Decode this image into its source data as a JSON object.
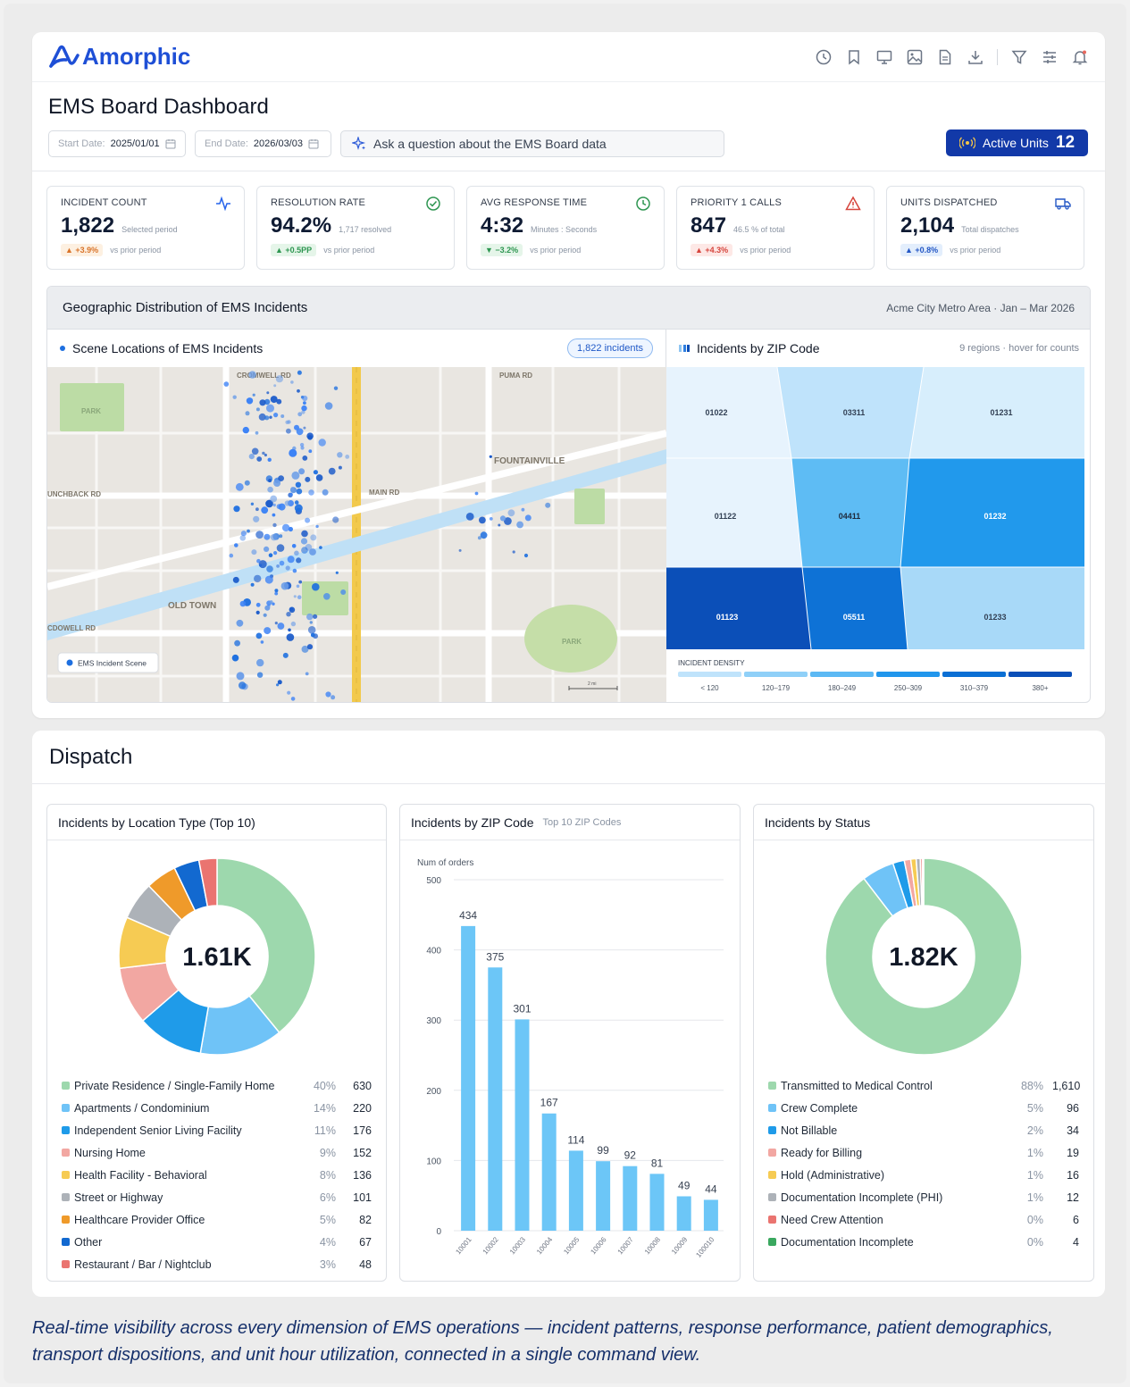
{
  "app": {
    "brand": "Amorphic",
    "brand_color": "#1e4fd6"
  },
  "toolbar_icons": [
    "history-icon",
    "bookmark-icon",
    "monitor-icon",
    "image-icon",
    "document-icon",
    "download-icon",
    "filter-icon",
    "settings-sliders-icon",
    "bell-icon"
  ],
  "header": {
    "title": "EMS Board Dashboard",
    "start_label": "Start Date:",
    "start_value": "2025/01/01",
    "end_label": "End Date:",
    "end_value": "2026/03/03",
    "ask_placeholder": "Ask a question about the EMS Board data",
    "active_units_label": "Active Units",
    "active_units_value": "12"
  },
  "kpis": [
    {
      "label": "INCIDENT COUNT",
      "value": "1,822",
      "sub": "Selected period",
      "delta": "▲ +3.9%",
      "delta_note": "vs prior period",
      "tone": "up-o",
      "icon": "pulse-icon"
    },
    {
      "label": "RESOLUTION RATE",
      "value": "94.2%",
      "sub": "1,717 resolved",
      "delta": "▲ +0.5PP",
      "delta_note": "vs prior period",
      "tone": "up-g",
      "icon": "check-circle-icon"
    },
    {
      "label": "AVG RESPONSE TIME",
      "value": "4:32",
      "sub": "Minutes : Seconds",
      "delta": "▼ −3.2%",
      "delta_note": "vs prior period",
      "tone": "down-g",
      "icon": "clock-icon"
    },
    {
      "label": "PRIORITY 1 CALLS",
      "value": "847",
      "sub": "46.5 % of total",
      "delta": "▲ +4.3%",
      "delta_note": "vs prior period",
      "tone": "up-r",
      "icon": "warning-icon"
    },
    {
      "label": "UNITS DISPATCHED",
      "value": "2,104",
      "sub": "Total dispatches",
      "delta": "▲ +0.8%",
      "delta_note": "vs prior period",
      "tone": "up-b",
      "icon": "truck-icon"
    }
  ],
  "geo": {
    "title": "Geographic Distribution of EMS Incidents",
    "subtitle": "Acme City Metro Area · Jan – Mar 2026",
    "map_title": "Scene Locations of EMS Incidents",
    "map_badge": "1,822 incidents",
    "map_legend": "EMS Incident Scene",
    "scale_label": "2 mi",
    "road_labels": [
      "CROMWELL RD",
      "PUMA RD",
      "FOUNTAINVILLE",
      "UNCHBACK RD",
      "MAIN RD",
      "OLD TOWN",
      "CDOWELL RD",
      "PARK",
      "PARK"
    ],
    "zip_title": "Incidents by ZIP Code",
    "zip_hint": "9 regions · hover for counts",
    "zip_cells": [
      "01022",
      "03311",
      "01231",
      "01122",
      "04411",
      "01232",
      "01123",
      "05511",
      "01233"
    ],
    "density_title": "INCIDENT DENSITY",
    "density_bins": [
      "< 120",
      "120–179",
      "180–249",
      "250–309",
      "310–379",
      "380+"
    ],
    "density_colors": [
      "#bfe3fb",
      "#8fd0f8",
      "#5cb9f4",
      "#2196ec",
      "#0b6fd4",
      "#0b4fb8"
    ]
  },
  "dispatch": {
    "title": "Dispatch",
    "location_panel": {
      "title": "Incidents by Location Type (Top 10)",
      "center": "1.61K",
      "items": [
        {
          "name": "Private Residence / Single-Family Home",
          "pct": "40%",
          "value": "630",
          "color": "#9dd8ad"
        },
        {
          "name": "Apartments / Condominium",
          "pct": "14%",
          "value": "220",
          "color": "#6fc3f7"
        },
        {
          "name": "Independent Senior Living Facility",
          "pct": "11%",
          "value": "176",
          "color": "#1f9be9"
        },
        {
          "name": "Nursing Home",
          "pct": "9%",
          "value": "152",
          "color": "#f2a7a2"
        },
        {
          "name": "Health Facility - Behavioral",
          "pct": "8%",
          "value": "136",
          "color": "#f6cb53"
        },
        {
          "name": "Street or Highway",
          "pct": "6%",
          "value": "101",
          "color": "#adb2b8"
        },
        {
          "name": "Healthcare Provider Office",
          "pct": "5%",
          "value": "82",
          "color": "#ef9a2a"
        },
        {
          "name": "Other",
          "pct": "4%",
          "value": "67",
          "color": "#1269d0"
        },
        {
          "name": "Restaurant / Bar / Nightclub",
          "pct": "3%",
          "value": "48",
          "color": "#ea7470"
        }
      ]
    },
    "zip_panel": {
      "title": "Incidents by ZIP Code",
      "subtitle": "Top 10 ZIP Codes"
    },
    "status_panel": {
      "title": "Incidents by Status",
      "center": "1.82K",
      "items": [
        {
          "name": "Transmitted to Medical Control",
          "pct": "88%",
          "value": "1,610",
          "color": "#9dd8ad"
        },
        {
          "name": "Crew Complete",
          "pct": "5%",
          "value": "96",
          "color": "#6fc3f7"
        },
        {
          "name": "Not Billable",
          "pct": "2%",
          "value": "34",
          "color": "#1f9be9"
        },
        {
          "name": "Ready for Billing",
          "pct": "1%",
          "value": "19",
          "color": "#f2a7a2"
        },
        {
          "name": "Hold (Administrative)",
          "pct": "1%",
          "value": "16",
          "color": "#f6cb53"
        },
        {
          "name": "Documentation Incomplete (PHI)",
          "pct": "1%",
          "value": "12",
          "color": "#adb2b8"
        },
        {
          "name": "Need Crew Attention",
          "pct": "0%",
          "value": "6",
          "color": "#ea7470"
        },
        {
          "name": "Documentation Incomplete",
          "pct": "0%",
          "value": "4",
          "color": "#3aa85f"
        }
      ]
    }
  },
  "chart_data": [
    {
      "type": "pie",
      "title": "Incidents by Location Type (Top 10)",
      "center_label": "1.61K",
      "labels": [
        "Private Residence / Single-Family Home",
        "Apartments / Condominium",
        "Independent Senior Living Facility",
        "Nursing Home",
        "Health Facility - Behavioral",
        "Street or Highway",
        "Healthcare Provider Office",
        "Other",
        "Restaurant / Bar / Nightclub"
      ],
      "values": [
        630,
        220,
        176,
        152,
        136,
        101,
        82,
        67,
        48
      ]
    },
    {
      "type": "bar",
      "title": "Incidents by ZIP Code",
      "subtitle": "Top 10 ZIP Codes",
      "ylabel": "Num of orders",
      "categories": [
        "10001",
        "10002",
        "10003",
        "10004",
        "10005",
        "10006",
        "10007",
        "10008",
        "10009",
        "100010"
      ],
      "values": [
        434,
        375,
        301,
        167,
        114,
        99,
        92,
        81,
        49,
        44
      ],
      "ylim": [
        0,
        500
      ],
      "yticks": [
        0,
        100,
        200,
        300,
        400,
        500
      ],
      "color": "#6cc6f7"
    },
    {
      "type": "pie",
      "title": "Incidents by Status",
      "center_label": "1.82K",
      "labels": [
        "Transmitted to Medical Control",
        "Crew Complete",
        "Not Billable",
        "Ready for Billing",
        "Hold (Administrative)",
        "Documentation Incomplete (PHI)",
        "Need Crew Attention",
        "Documentation Incomplete"
      ],
      "values": [
        1610,
        96,
        34,
        19,
        16,
        12,
        6,
        4
      ]
    }
  ],
  "caption": "Real-time visibility across every dimension of EMS operations — incident patterns, response performance, patient demographics, transport dispositions, and unit hour utilization, connected in a single command view."
}
